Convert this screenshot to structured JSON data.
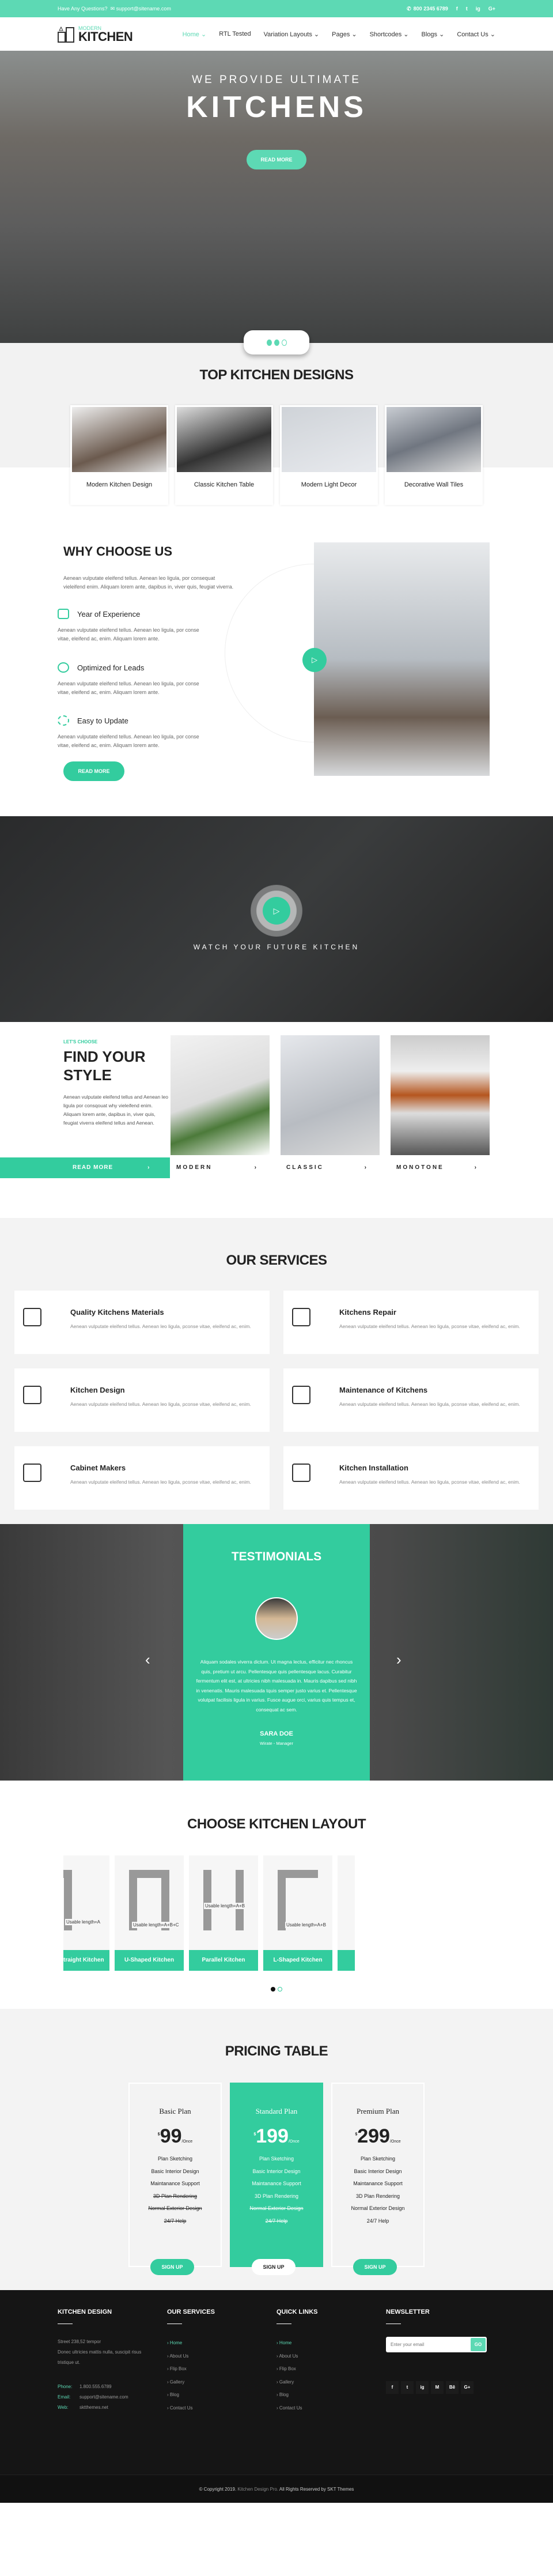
{
  "colors": {
    "accent": "#5dd9b4",
    "accent_dark": "#33cc9e",
    "footer": "#151515"
  },
  "topbar": {
    "question": "Have Any Questions?",
    "email": "support@sitename.com",
    "phone": "800 2345 6789",
    "social": [
      "f",
      "t",
      "ig",
      "G+"
    ]
  },
  "nav": {
    "logo_small": "MODERN",
    "logo_big": "KITCHEN",
    "items": [
      {
        "label": "Home ⌄"
      },
      {
        "label": "RTL Tested"
      },
      {
        "label": "Variation Layouts ⌄"
      },
      {
        "label": "Pages ⌄"
      },
      {
        "label": "Shortcodes ⌄"
      },
      {
        "label": "Blogs ⌄"
      },
      {
        "label": "Contact Us ⌄"
      }
    ]
  },
  "hero": {
    "kicker": "WE PROVIDE ULTIMATE",
    "title": "KITCHENS",
    "button": "READ MORE",
    "slide_count": 3,
    "active_slide": 2
  },
  "designs": {
    "title": "TOP KITCHEN DESIGNS",
    "cards": [
      {
        "label": "Modern Kitchen Design"
      },
      {
        "label": "Classic Kitchen Table"
      },
      {
        "label": "Modern Light Decor"
      },
      {
        "label": "Decorative Wall Tiles"
      }
    ]
  },
  "why": {
    "title": "WHY CHOOSE US",
    "intro": "Aenean vulputate eleifend tellus. Aenean leo ligula, por consequat vieleifend enim. Aliquam lorem ante, dapibus in, viver quis, feugiat viverra.",
    "features": [
      {
        "icon": "ruler-triangle-icon",
        "title": "Year of Experience",
        "text": "Aenean vulputate eleifend tellus. Aenean leo ligula, por conse vitae, eleifend ac, enim. Aliquam lorem ante."
      },
      {
        "icon": "alarm-clock-icon",
        "title": "Optimized for Leads",
        "text": "Aenean vulputate eleifend tellus. Aenean leo ligula, por conse vitae, eleifend ac, enim. Aliquam lorem ante."
      },
      {
        "icon": "refresh-icon",
        "title": "Easy to Update",
        "text": "Aenean vulputate eleifend tellus. Aenean leo ligula, por conse vitae, eleifend ac, enim. Aliquam lorem ante."
      }
    ],
    "button": "READ MORE"
  },
  "video": {
    "title": "WATCH YOUR FUTURE KITCHEN"
  },
  "style": {
    "kicker": "LET'S CHOOSE",
    "title": "FIND YOUR STYLE",
    "text": "Aenean vulputate eleifend tellus and Aenean leo ligula por consqouat why vieleifend enim. Aliquam lorem ante, dapibus in, viver quis, feugiat viverra eleifend tellus and Aenean.",
    "button": "READ MORE",
    "cards": [
      {
        "label": "MODERN"
      },
      {
        "label": "CLASSIC"
      },
      {
        "label": "MONOTONE"
      }
    ]
  },
  "services": {
    "title": "OUR SERVICES",
    "items": [
      {
        "title": "Quality Kitchens Materials",
        "text": "Aenean vulputate eleifend tellus. Aenean leo ligula, pconse vitae, eleifend ac, enim."
      },
      {
        "title": "Kitchens Repair",
        "text": "Aenean vulputate eleifend tellus. Aenean leo ligula, pconse vitae, eleifend ac, enim."
      },
      {
        "title": "Kitchen Design",
        "text": "Aenean vulputate eleifend tellus. Aenean leo ligula, pconse vitae, eleifend ac, enim."
      },
      {
        "title": "Maintenance of Kitchens",
        "text": "Aenean vulputate eleifend tellus. Aenean leo ligula, pconse vitae, eleifend ac, enim."
      },
      {
        "title": "Cabinet Makers",
        "text": "Aenean vulputate eleifend tellus. Aenean leo ligula, pconse vitae, eleifend ac, enim."
      },
      {
        "title": "Kitchen Installation",
        "text": "Aenean vulputate eleifend tellus. Aenean leo ligula, pconse vitae, eleifend ac, enim."
      }
    ]
  },
  "testimonials": {
    "title": "TESTIMONIALS",
    "quote": "Aliquam sodales viverra dictum. Ut magna lectus, efficitur nec rhoncus quis, pretium ut arcu. Pellentesque quis pellentesque lacus. Curabitur fermentum elit est, at ultricies nibh malesuada in. Mauris dapibus sed nibh in venenatis. Mauris malesuada tquis semper justo varius et. Pellentesque volutpat facilisis ligula in varius. Fusce augue orci, varius quis tempus et, consequat ac sem.",
    "name": "SARA DOE",
    "role": "Wirate - Manager"
  },
  "layouts": {
    "title": "CHOOSE KITCHEN LAYOUT",
    "cards": [
      {
        "label": "traight Kitchen",
        "note": "Usable length=A"
      },
      {
        "label": "U-Shaped Kitchen",
        "note": "Usable length=A+B+C"
      },
      {
        "label": "Parallel Kitchen",
        "note": "Usable length=A+B"
      },
      {
        "label": "L-Shaped Kitchen",
        "note": "Usable length=A+B"
      },
      {
        "label": "",
        "note": ""
      }
    ],
    "page_count": 2,
    "active_page": 1
  },
  "pricing": {
    "title": "PRICING TABLE",
    "plans": [
      {
        "name": "Basic Plan",
        "currency": "$",
        "price": "99",
        "period": "/Once",
        "features": [
          {
            "t": "Plan Sketching",
            "on": true
          },
          {
            "t": "Basic Interior Design",
            "on": true
          },
          {
            "t": "Maintanance Support",
            "on": true
          },
          {
            "t": "3D Plan Rendering",
            "on": false
          },
          {
            "t": "Normal Exterior Design",
            "on": false
          },
          {
            "t": "24/7 Help",
            "on": false
          }
        ],
        "button": "SIGN UP"
      },
      {
        "name": "Standard Plan",
        "currency": "$",
        "price": "199",
        "period": "/Once",
        "features": [
          {
            "t": "Plan Sketching",
            "on": true
          },
          {
            "t": "Basic Interior Design",
            "on": true
          },
          {
            "t": "Maintanance Support",
            "on": true
          },
          {
            "t": "3D Plan Rendering",
            "on": true
          },
          {
            "t": "Normal Exterior Design",
            "on": false
          },
          {
            "t": "24/7 Help",
            "on": false
          }
        ],
        "button": "SIGN UP",
        "highlighted": true
      },
      {
        "name": "Premium Plan",
        "currency": "$",
        "price": "299",
        "period": "/Once",
        "features": [
          {
            "t": "Plan Sketching",
            "on": true
          },
          {
            "t": "Basic Interior Design",
            "on": true
          },
          {
            "t": "Maintanance Support",
            "on": true
          },
          {
            "t": "3D Plan Rendering",
            "on": true
          },
          {
            "t": "Normal Exterior Design",
            "on": true
          },
          {
            "t": "24/7 Help",
            "on": true
          }
        ],
        "button": "SIGN UP"
      }
    ]
  },
  "footer": {
    "about": {
      "title": "KITCHEN DESIGN",
      "address1": "Street 238,52 tempor",
      "address2": "Donec ultricies mattis nulla, suscipit risus tristique ut.",
      "phone_label": "Phone:",
      "phone": "1.800.555.6789",
      "email_label": "Email:",
      "email": "support@sitename.com",
      "web_label": "Web:",
      "web": "sktthemes.net"
    },
    "services": {
      "title": "OUR SERVICES",
      "links": [
        "Home",
        "About Us",
        "Flip Box",
        "Gallery",
        "Blog",
        "Contact Us"
      ]
    },
    "quick": {
      "title": "QUICK LINKS",
      "links": [
        "Home",
        "About Us",
        "Flip Box",
        "Gallery",
        "Blog",
        "Contact Us"
      ]
    },
    "newsletter": {
      "title": "NEWSLETTER",
      "placeholder": "Enter your email",
      "button": "GO",
      "social": [
        "f",
        "t",
        "ig",
        "M",
        "Bē",
        "G+"
      ]
    },
    "copyright_a": "© Copyright 2019.",
    "copyright_b": "Kitchen Design Pro.",
    "copyright_c": "All Rights Reserved by SKT Themes"
  }
}
